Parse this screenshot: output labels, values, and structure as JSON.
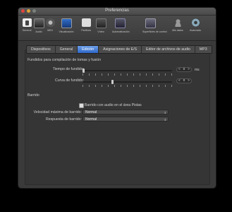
{
  "window": {
    "title": "Preferencias"
  },
  "toolbar": {
    "items": [
      {
        "label": "General",
        "icon": "general-icon"
      },
      {
        "label": "Audio",
        "icon": "audio-icon"
      },
      {
        "label": "MIDI",
        "icon": "midi-icon"
      },
      {
        "label": "Visualización",
        "icon": "display-icon"
      },
      {
        "label": "Partitura",
        "icon": "score-icon"
      },
      {
        "label": "Vídeo",
        "icon": "video-icon"
      },
      {
        "label": "Automatización",
        "icon": "automation-icon"
      },
      {
        "label": "Superficies de control",
        "icon": "control-surfaces-icon"
      },
      {
        "label": "Mis datos",
        "icon": "user-icon"
      },
      {
        "label": "Avanzado",
        "icon": "advanced-icon"
      }
    ],
    "selected": "General"
  },
  "tabs": [
    "Dispositivos",
    "General",
    "Edición",
    "Asignaciones de E/S",
    "Editor de archivos de audio",
    "MP3"
  ],
  "active_tab": "Edición",
  "sections": {
    "fades": {
      "title": "Fundidos para compilación de tomas y fusión",
      "fade_time": {
        "label": "Tiempo de fundido:",
        "value": "0",
        "unit": "ms"
      },
      "fade_curve": {
        "label": "Curva de fundido:",
        "value": "0"
      }
    },
    "scrub": {
      "title": "Barrido",
      "checkbox_label": "Barrido con audio en el área Pistas",
      "checkbox_checked": false,
      "max_speed": {
        "label": "Velocidad máxima de barrido:",
        "value": "Normal"
      },
      "response": {
        "label": "Respuesta de barrido:",
        "value": "Normal"
      }
    }
  }
}
